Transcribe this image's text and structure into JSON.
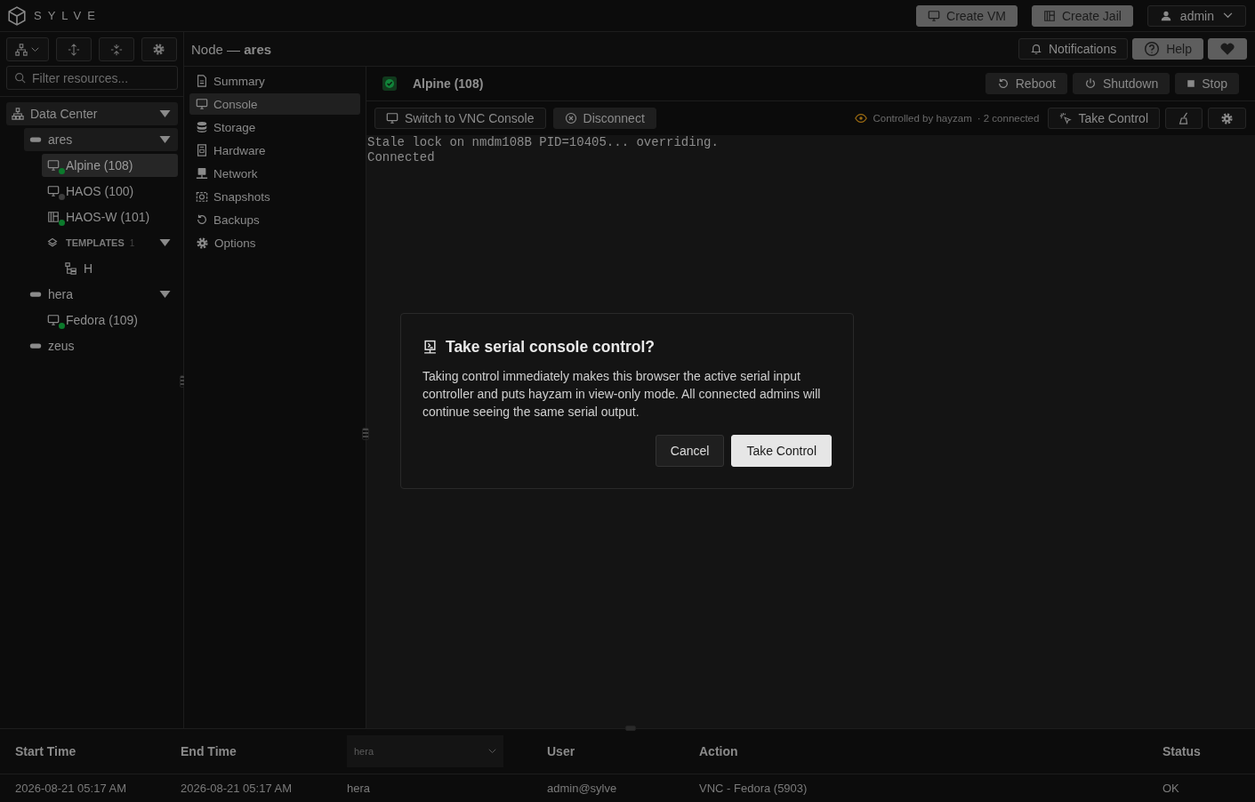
{
  "brand": "SYLVE",
  "top_actions": [
    {
      "label": "Create VM",
      "kind": "monitor"
    },
    {
      "label": "Create Jail",
      "kind": "jail"
    }
  ],
  "user": "admin",
  "sidebar": {
    "filter": {
      "placeholder": "Filter resources..."
    },
    "tree": [
      {
        "label": "Data Center",
        "kind": "datacenter",
        "expanded": true,
        "selected": false,
        "children": [
          {
            "label": "ares",
            "kind": "node",
            "expanded": true,
            "selected": false,
            "children": [
              {
                "label": "Alpine (108)",
                "kind": "vm",
                "selected": true,
                "color": "#0c7a2c"
              },
              {
                "label": "HAOS (100)",
                "kind": "vm",
                "selected": false,
                "color": "#3d3d3d"
              },
              {
                "label": "HAOS-W (101)",
                "kind": "jail",
                "selected": false,
                "color": "#0c7a2c"
              },
              {
                "label": "TEMPLATES",
                "count": "1",
                "kind": "group",
                "expanded": true,
                "selected": false,
                "children": [
                  {
                    "label": "H",
                    "kind": "template",
                    "selected": false
                  }
                ]
              }
            ]
          },
          {
            "label": "hera",
            "kind": "node",
            "expanded": true,
            "selected": false,
            "children": [
              {
                "label": "Fedora (109)",
                "kind": "vm",
                "selected": false,
                "color": "#0c7a2c"
              }
            ]
          },
          {
            "label": "zeus",
            "kind": "node",
            "selected": false
          }
        ]
      }
    ]
  },
  "node_header": {
    "title": "Node — **ares**",
    "buttons": [
      {
        "label": "Notifications",
        "kind": "bell"
      },
      {
        "label": "Help",
        "kind": "help"
      },
      {
        "kind": "heart"
      }
    ]
  },
  "menu": [
    {
      "label": "Summary",
      "kind": "summary",
      "selected": false
    },
    {
      "label": "Console",
      "kind": "console",
      "selected": true
    },
    {
      "label": "Storage",
      "kind": "storage",
      "selected": false
    },
    {
      "label": "Hardware",
      "kind": "hardware",
      "selected": false
    },
    {
      "label": "Network",
      "kind": "network",
      "selected": false
    },
    {
      "label": "Snapshots",
      "kind": "snapshots",
      "selected": false
    },
    {
      "label": "Backups",
      "kind": "backups",
      "selected": false
    },
    {
      "label": "Options",
      "kind": "options",
      "selected": false
    }
  ],
  "vm": {
    "name": "Alpine (108)",
    "actions": [
      {
        "label": "Reboot",
        "kind": "reboot"
      },
      {
        "label": "Shutdown",
        "kind": "power"
      },
      {
        "label": "Stop",
        "kind": "stop"
      }
    ]
  },
  "console": {
    "buttons": [
      {
        "label": "Switch to VNC Console",
        "kind": "monitor"
      },
      {
        "label": "Disconnect",
        "kind": "disconnect"
      }
    ],
    "controlled_by": "Controlled by hayzam",
    "connected": "· 2 connected",
    "take_control": "Take Control",
    "lines": [
      "Stale lock on nmdm108B PID=10405... overriding.",
      "Connected"
    ]
  },
  "dialog": {
    "title": "Take serial console control?",
    "body": "Taking control immediately makes this browser the active serial input controller and puts hayzam in view-only mode. All connected admins will continue seeing the same serial output.",
    "buttons": [
      {
        "label": "Cancel",
        "kind": "secondary"
      },
      {
        "label": "Take Control",
        "kind": "primary"
      }
    ]
  },
  "table": {
    "columns": [
      "Start Time",
      "End Time",
      {
        "filter": "hera"
      },
      "User",
      "Action",
      "Status"
    ],
    "rows": [
      [
        "2026-08-21 05:17 AM",
        "2026-08-21 05:17 AM",
        "hera",
        "admin@sylve",
        "VNC - Fedora (5903)",
        "OK"
      ]
    ]
  }
}
